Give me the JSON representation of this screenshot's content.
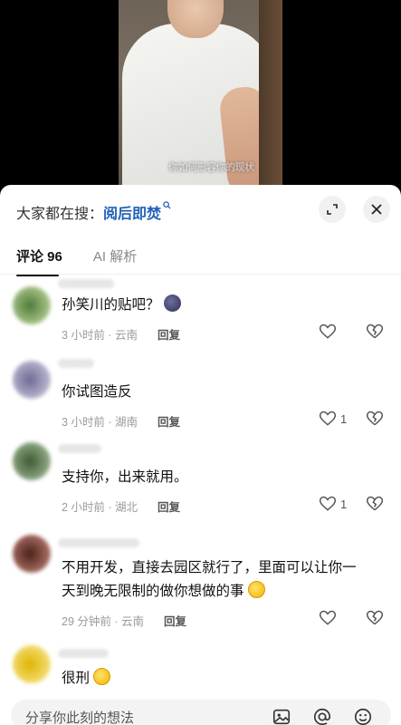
{
  "video": {
    "subtitle": "你如何形容你的现状"
  },
  "header": {
    "search_prefix": "大家都在搜：",
    "search_keyword": "阅后即焚",
    "search_icon": "search-icon"
  },
  "tabs": [
    {
      "label": "评论 96",
      "active": true
    },
    {
      "label": "AI 解析",
      "active": false
    }
  ],
  "comments": [
    {
      "text": "孙笑川的贴吧？",
      "emoji": "blob-emoji",
      "meta": "3 小时前 · 云南",
      "reply": "回复",
      "likes": ""
    },
    {
      "text": "你试图造反",
      "emoji": "",
      "meta": "3 小时前 · 湖南",
      "reply": "回复",
      "likes": "1"
    },
    {
      "text": "支持你，出来就用。",
      "emoji": "",
      "meta": "2 小时前 · 湖北",
      "reply": "回复",
      "likes": "1"
    },
    {
      "text": "不用开发，直接去园区就行了，里面可以让你一天到晚无限制的做你想做的事",
      "emoji": "laugh-cry-emoji",
      "meta": "29 分钟前 · 云南",
      "reply": "回复",
      "likes": ""
    },
    {
      "text": "很刑",
      "emoji": "grin-emoji",
      "meta": "",
      "reply": "",
      "likes": ""
    }
  ],
  "input": {
    "placeholder": "分享你此刻的想法"
  }
}
